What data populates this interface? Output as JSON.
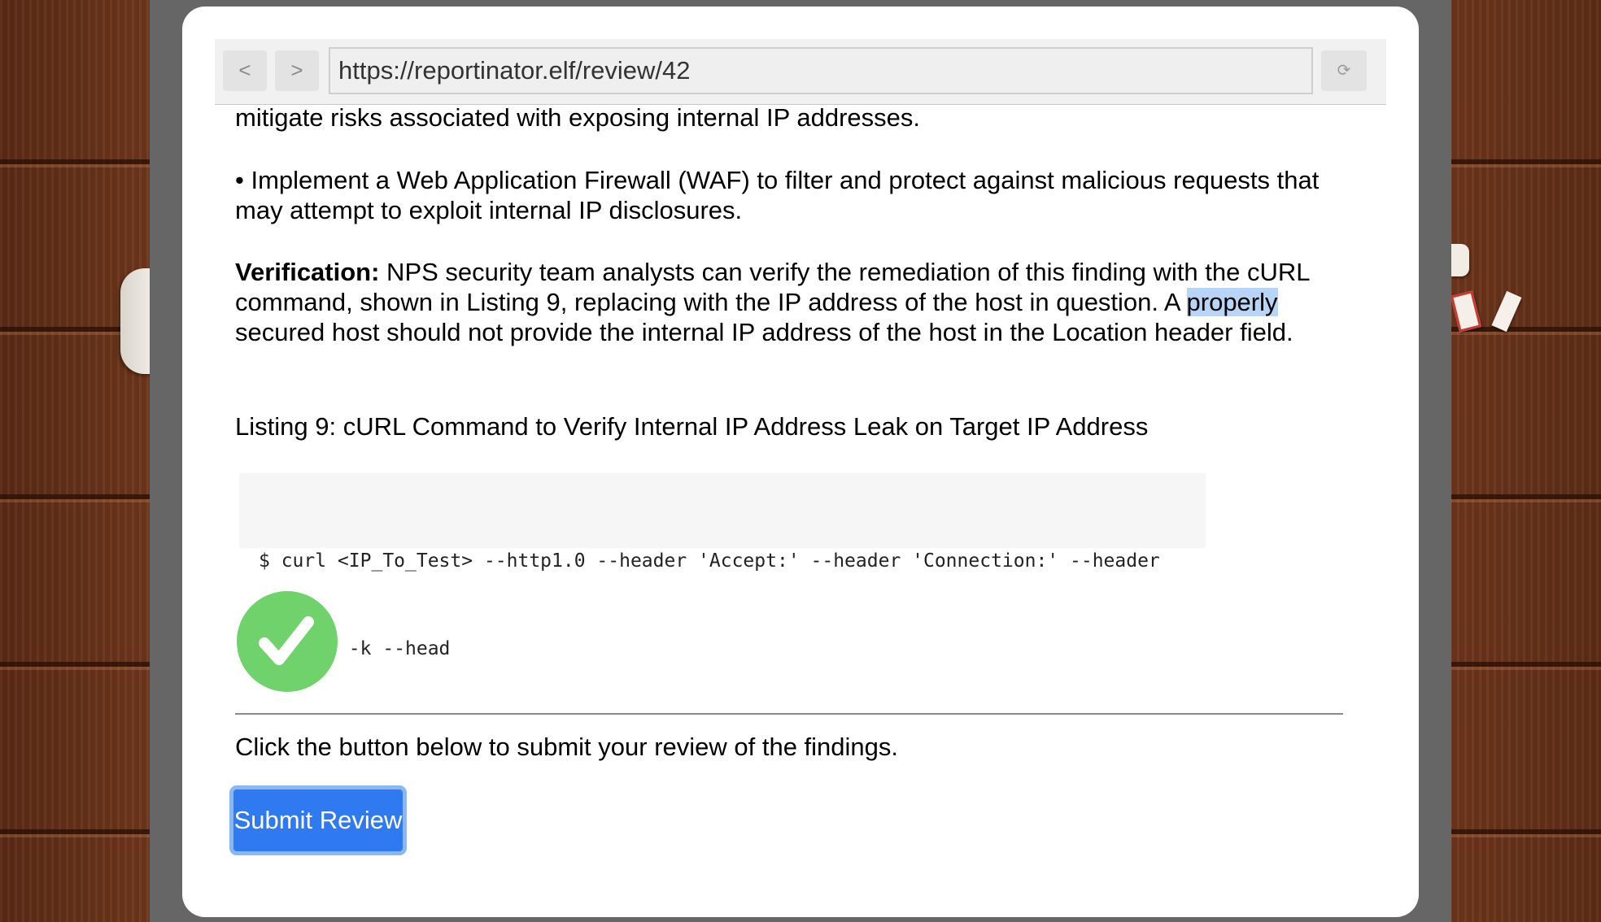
{
  "browser": {
    "back_label": "<",
    "forward_label": ">",
    "url": "https://reportinator.elf/review/42",
    "reload_icon": "⟳"
  },
  "report": {
    "para_mitigate": "mitigate risks associated with exposing internal IP addresses.",
    "bullet_waf": "• Implement a Web Application Firewall (WAF) to filter and protect against malicious requests that may attempt to exploit internal IP disclosures.",
    "verification_label": "Verification:",
    "verification_text_1": " NPS security team analysts can verify the remediation of this finding with the cURL command, shown in Listing 9, replacing with the IP address of the host in question. A ",
    "verification_highlight": "properly",
    "verification_text_2": " secured host should not provide the internal IP address of the host in the Location header field.",
    "listing_caption": "Listing 9: cURL Command to Verify Internal IP Address Leak on Target IP Address",
    "code_line_1": "$ curl <IP_To_Test> --http1.0 --header 'Accept:' --header 'Connection:' --header",
    "code_line_2": "'Host:' -k --head"
  },
  "review": {
    "status_icon": "checkmark-icon",
    "status_color": "#6fd26b",
    "instruction": "Click the button below to submit your review of the findings.",
    "submit_label": "Submit Review"
  },
  "colors": {
    "accent": "#2f7af0",
    "highlight": "#b8d4f6"
  }
}
